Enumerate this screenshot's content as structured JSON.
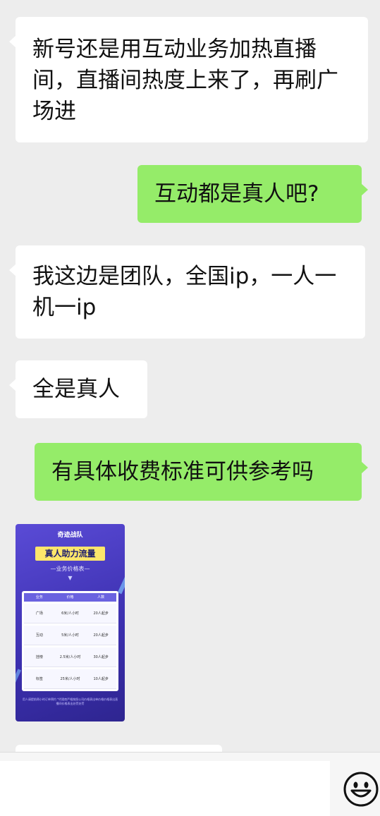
{
  "messages": [
    {
      "id": "m1",
      "side": "incoming",
      "text": "新号还是用互动业务加热直播间，直播间热度上来了，再刷广场进"
    },
    {
      "id": "m2",
      "side": "outgoing",
      "text": "互动都是真人吧?"
    },
    {
      "id": "m3",
      "side": "incoming",
      "text": "我这边是团队，全国ip，一人一机一ip"
    },
    {
      "id": "m4",
      "side": "incoming",
      "text": "全是真人"
    },
    {
      "id": "m5",
      "side": "outgoing",
      "text": "有具体收费标准可供参考吗"
    }
  ],
  "image_card": {
    "brand": "奇迹战队",
    "headline": "真人助力流量",
    "subtitle": "—业务价格表—",
    "columns": [
      "业务",
      "价格",
      "人数"
    ],
    "rows": [
      [
        "广场",
        "6米/人小时",
        "20人起步"
      ],
      [
        "互动",
        "5米/人小时",
        "20人起步"
      ],
      [
        "挂榜",
        "2.5米/人小时",
        "30人起步"
      ],
      [
        "标签",
        "25米/人小时",
        "10人起步"
      ]
    ],
    "footer": "用人请提前两小时订单预约 *代理商严格按照公司价格表出单价格价格表出直播间价格表出处罚处罚"
  },
  "colors": {
    "background": "#ededed",
    "incoming_bubble": "#ffffff",
    "outgoing_bubble": "#95ec69"
  },
  "input_bar": {
    "emoji_icon": "smiley-face-icon"
  }
}
